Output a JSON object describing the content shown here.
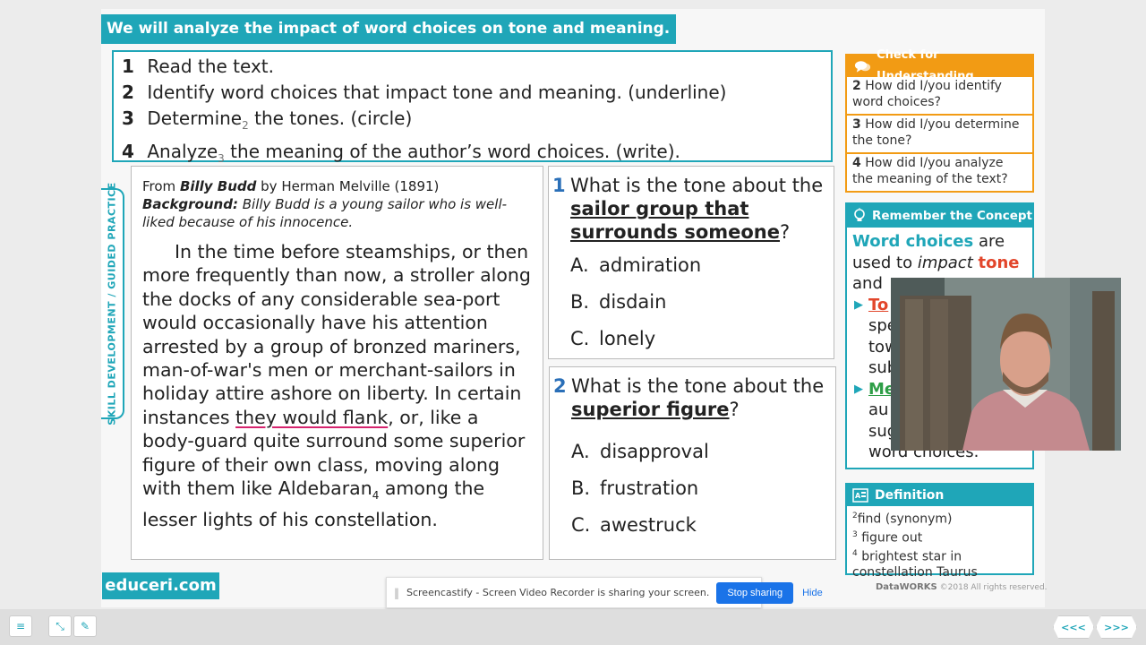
{
  "header": {
    "title": "We will analyze the impact of word choices on tone and meaning."
  },
  "steps": [
    {
      "num": "1",
      "text": "Read the text.",
      "sub": "",
      "rest": ""
    },
    {
      "num": "2",
      "text": "Identify word choices that impact tone and meaning. (underline)",
      "sub": "",
      "rest": ""
    },
    {
      "num": "3",
      "text": "Determine",
      "sub": "2",
      "rest": " the tones. (circle)"
    },
    {
      "num": "4",
      "text": "Analyze",
      "sub": "3",
      "rest": " the meaning of the author’s word choices. (write)."
    }
  ],
  "side_tab": {
    "label": "SKILL DEVELOPMENT / GUIDED PRACTICE"
  },
  "passage": {
    "source_prefix": "From ",
    "source_title": "Billy Budd",
    "source_suffix": " by Herman Melville (1891)",
    "background_label": "Background:",
    "background_title": "Billy Budd",
    "background_text": " is a young sailor who is well-liked because of his innocence.",
    "text_before": "In the time before steamships, or then more frequently than now, a stroller along the docks of any considerable sea-port would occasionally have his attention arrested by a group of bronzed mariners, man-of-war's men or merchant-sailors in holiday attire ashore on liberty. In certain instances ",
    "text_underlined": "they would flank",
    "text_middle": ", or, like a body-guard quite surround some superior figure of their own class, moving along with them like Aldebaran",
    "text_sub": "4",
    "text_after": " among the lesser lights of his constellation."
  },
  "question1": {
    "num": "1",
    "prefix": "What is the tone about the ",
    "emphasis": "sailor group that surrounds someone",
    "suffix": "?",
    "options": [
      {
        "letter": "A.",
        "text": "admiration"
      },
      {
        "letter": "B.",
        "text": "disdain"
      },
      {
        "letter": "C.",
        "text": "lonely"
      }
    ]
  },
  "question2": {
    "num": "2",
    "prefix": "What is the tone about the ",
    "emphasis": "superior figure",
    "suffix": "?",
    "options": [
      {
        "letter": "A.",
        "text": "disapproval"
      },
      {
        "letter": "B.",
        "text": "frustration"
      },
      {
        "letter": "C.",
        "text": "awestruck"
      }
    ]
  },
  "check_understanding": {
    "title": "Check for Understanding",
    "items": [
      {
        "num": "2",
        "text": "How did I/you identify word choices?"
      },
      {
        "num": "3",
        "text": "How did I/you determine the tone?"
      },
      {
        "num": "4",
        "text": "How did I/you analyze the meaning of the text?"
      }
    ]
  },
  "remember_concept": {
    "title": "Remember the Concept",
    "term": "Word choices",
    "line1_rest": " are used to ",
    "impact": "impact",
    "tone": "tone",
    "and": "and",
    "bullet1_visible": "To",
    "bullet1_lines": [
      "spe",
      "tow",
      "sub"
    ],
    "bullet2_visible": "Me",
    "bullet2_lines": [
      "au",
      "sug"
    ],
    "last_line": "word choices."
  },
  "definition": {
    "title": "Definition",
    "items": [
      {
        "num": "2",
        "text": "find (synonym)"
      },
      {
        "num": "3",
        "text": "figure out"
      },
      {
        "num": "4",
        "text": "brightest star in constellation Taurus"
      }
    ]
  },
  "brand": {
    "text": "educeri.com"
  },
  "copyright": {
    "company": "DataWORKS",
    "text": "©2018 All rights reserved."
  },
  "share_bar": {
    "message": "Screencastify - Screen Video Recorder is sharing your screen.",
    "stop_label": "Stop sharing",
    "hide_label": "Hide"
  },
  "nav": {
    "prev_label": "<<<",
    "next_label": ">>>"
  },
  "colors": {
    "teal": "#1fa6b8",
    "orange": "#f29b14",
    "red": "#e2462b",
    "green": "#2e9e47",
    "blue": "#1a73e8"
  }
}
